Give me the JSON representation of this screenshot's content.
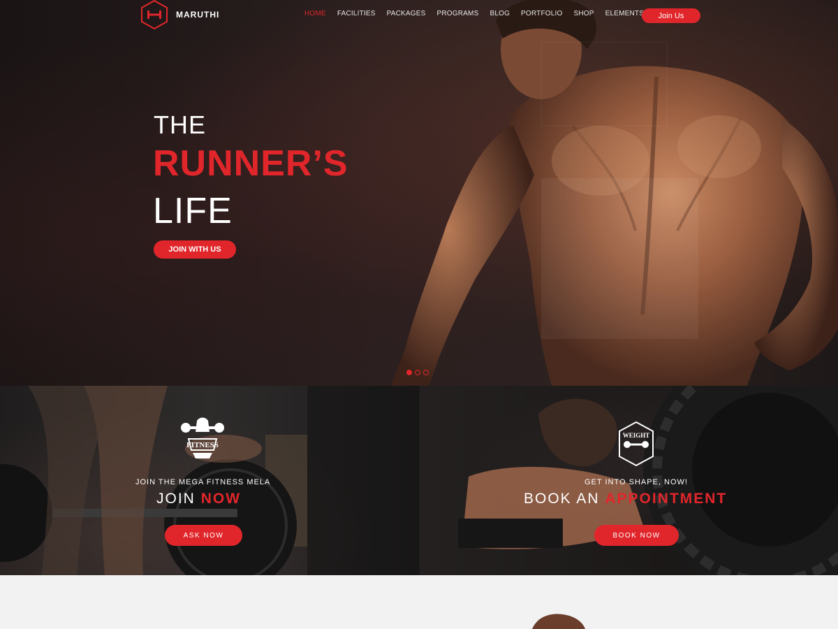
{
  "brand": {
    "name": "MARUTHI"
  },
  "nav": {
    "items": [
      {
        "label": "HOME",
        "active": true
      },
      {
        "label": "FACILITIES",
        "active": false
      },
      {
        "label": "PACKAGES",
        "active": false
      },
      {
        "label": "PROGRAMS",
        "active": false
      },
      {
        "label": "BLOG",
        "active": false
      },
      {
        "label": "PORTFOLIO",
        "active": false
      },
      {
        "label": "SHOP",
        "active": false
      },
      {
        "label": "ELEMENTS",
        "active": false
      }
    ],
    "join_label": "Join Us"
  },
  "hero": {
    "line1": "THE",
    "line2": "RUNNER’S",
    "line3": "LIFE",
    "button": "JOIN WITH US",
    "slides": 3,
    "active_slide": 1
  },
  "promo_left": {
    "badge_text": "FITNESS",
    "subtitle": "JOIN THE MEGA FITNESS MELA",
    "title_plain": "JOIN",
    "title_highlight": "NOW",
    "button": "ASK NOW"
  },
  "promo_right": {
    "badge_text": "WEIGHT",
    "subtitle": "GET INTO SHAPE, NOW!",
    "title_plain": "BOOK AN",
    "title_highlight": "APPOINTMENT",
    "button": "BOOK NOW"
  },
  "colors": {
    "accent": "#e1262b",
    "dark": "#1e1818",
    "light": "#f2f2f2"
  }
}
